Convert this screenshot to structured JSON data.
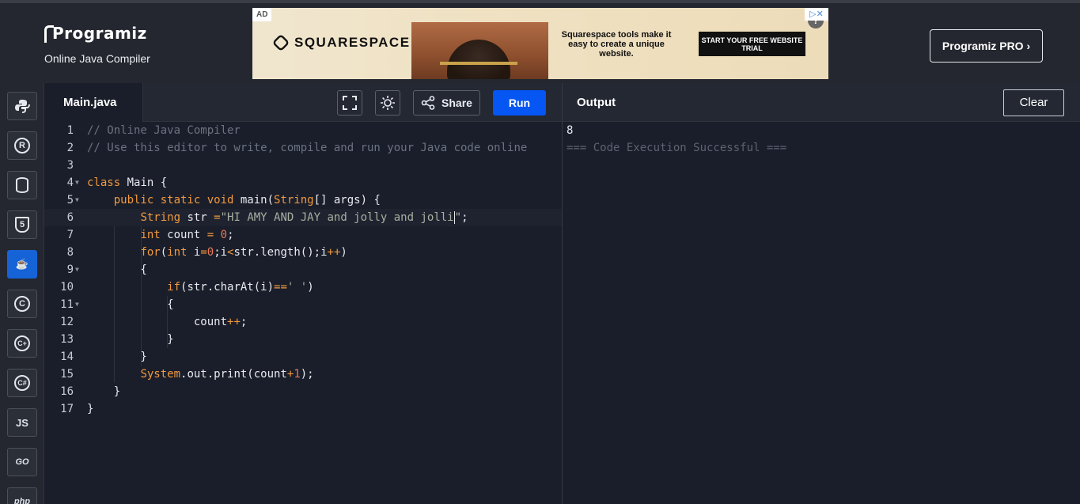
{
  "header": {
    "brand_name": "Programiz",
    "brand_subtitle": "Online Java Compiler",
    "pro_button": "Programiz PRO ›"
  },
  "ad": {
    "badge": "AD",
    "advertiser": "SQUARESPACE",
    "copy": "Squarespace tools make it easy to create a unique website.",
    "cta": "START YOUR FREE WEBSITE TRIAL",
    "close_icon": "close-icon"
  },
  "sidebar": {
    "items": [
      {
        "name": "python",
        "label": "",
        "icon": "python-icon"
      },
      {
        "name": "r",
        "label": "R",
        "icon": "r-icon"
      },
      {
        "name": "sql",
        "label": "",
        "icon": "database-icon"
      },
      {
        "name": "html",
        "label": "5",
        "icon": "html5-icon"
      },
      {
        "name": "java",
        "label": "☕",
        "icon": "java-icon",
        "active": true
      },
      {
        "name": "c",
        "label": "C",
        "icon": "c-icon"
      },
      {
        "name": "cpp",
        "label": "C+",
        "icon": "cpp-icon"
      },
      {
        "name": "csharp",
        "label": "C#",
        "icon": "csharp-icon"
      },
      {
        "name": "javascript",
        "label": "JS",
        "icon": "js-icon"
      },
      {
        "name": "go",
        "label": "GO",
        "icon": "go-icon"
      },
      {
        "name": "php",
        "label": "php",
        "icon": "php-icon"
      }
    ]
  },
  "editor": {
    "tab_label": "Main.java",
    "share_label": "Share",
    "run_label": "Run",
    "lines": [
      "// Online Java Compiler",
      "// Use this editor to write, compile and run your Java code online",
      "",
      "class Main {",
      "    public static void main(String[] args) {",
      "        String str =\"HI AMY AND JAY and jolly and jolli\";",
      "        int count = 0;",
      "        for(int i=0;i<str.length();i++)",
      "        {",
      "            if(str.charAt(i)==' ')",
      "            {",
      "                count++;",
      "            }",
      "        }",
      "        System.out.print(count+1);",
      "    }",
      "}"
    ]
  },
  "output": {
    "title": "Output",
    "clear_label": "Clear",
    "result": "8",
    "status": "=== Code Execution Successful ==="
  }
}
